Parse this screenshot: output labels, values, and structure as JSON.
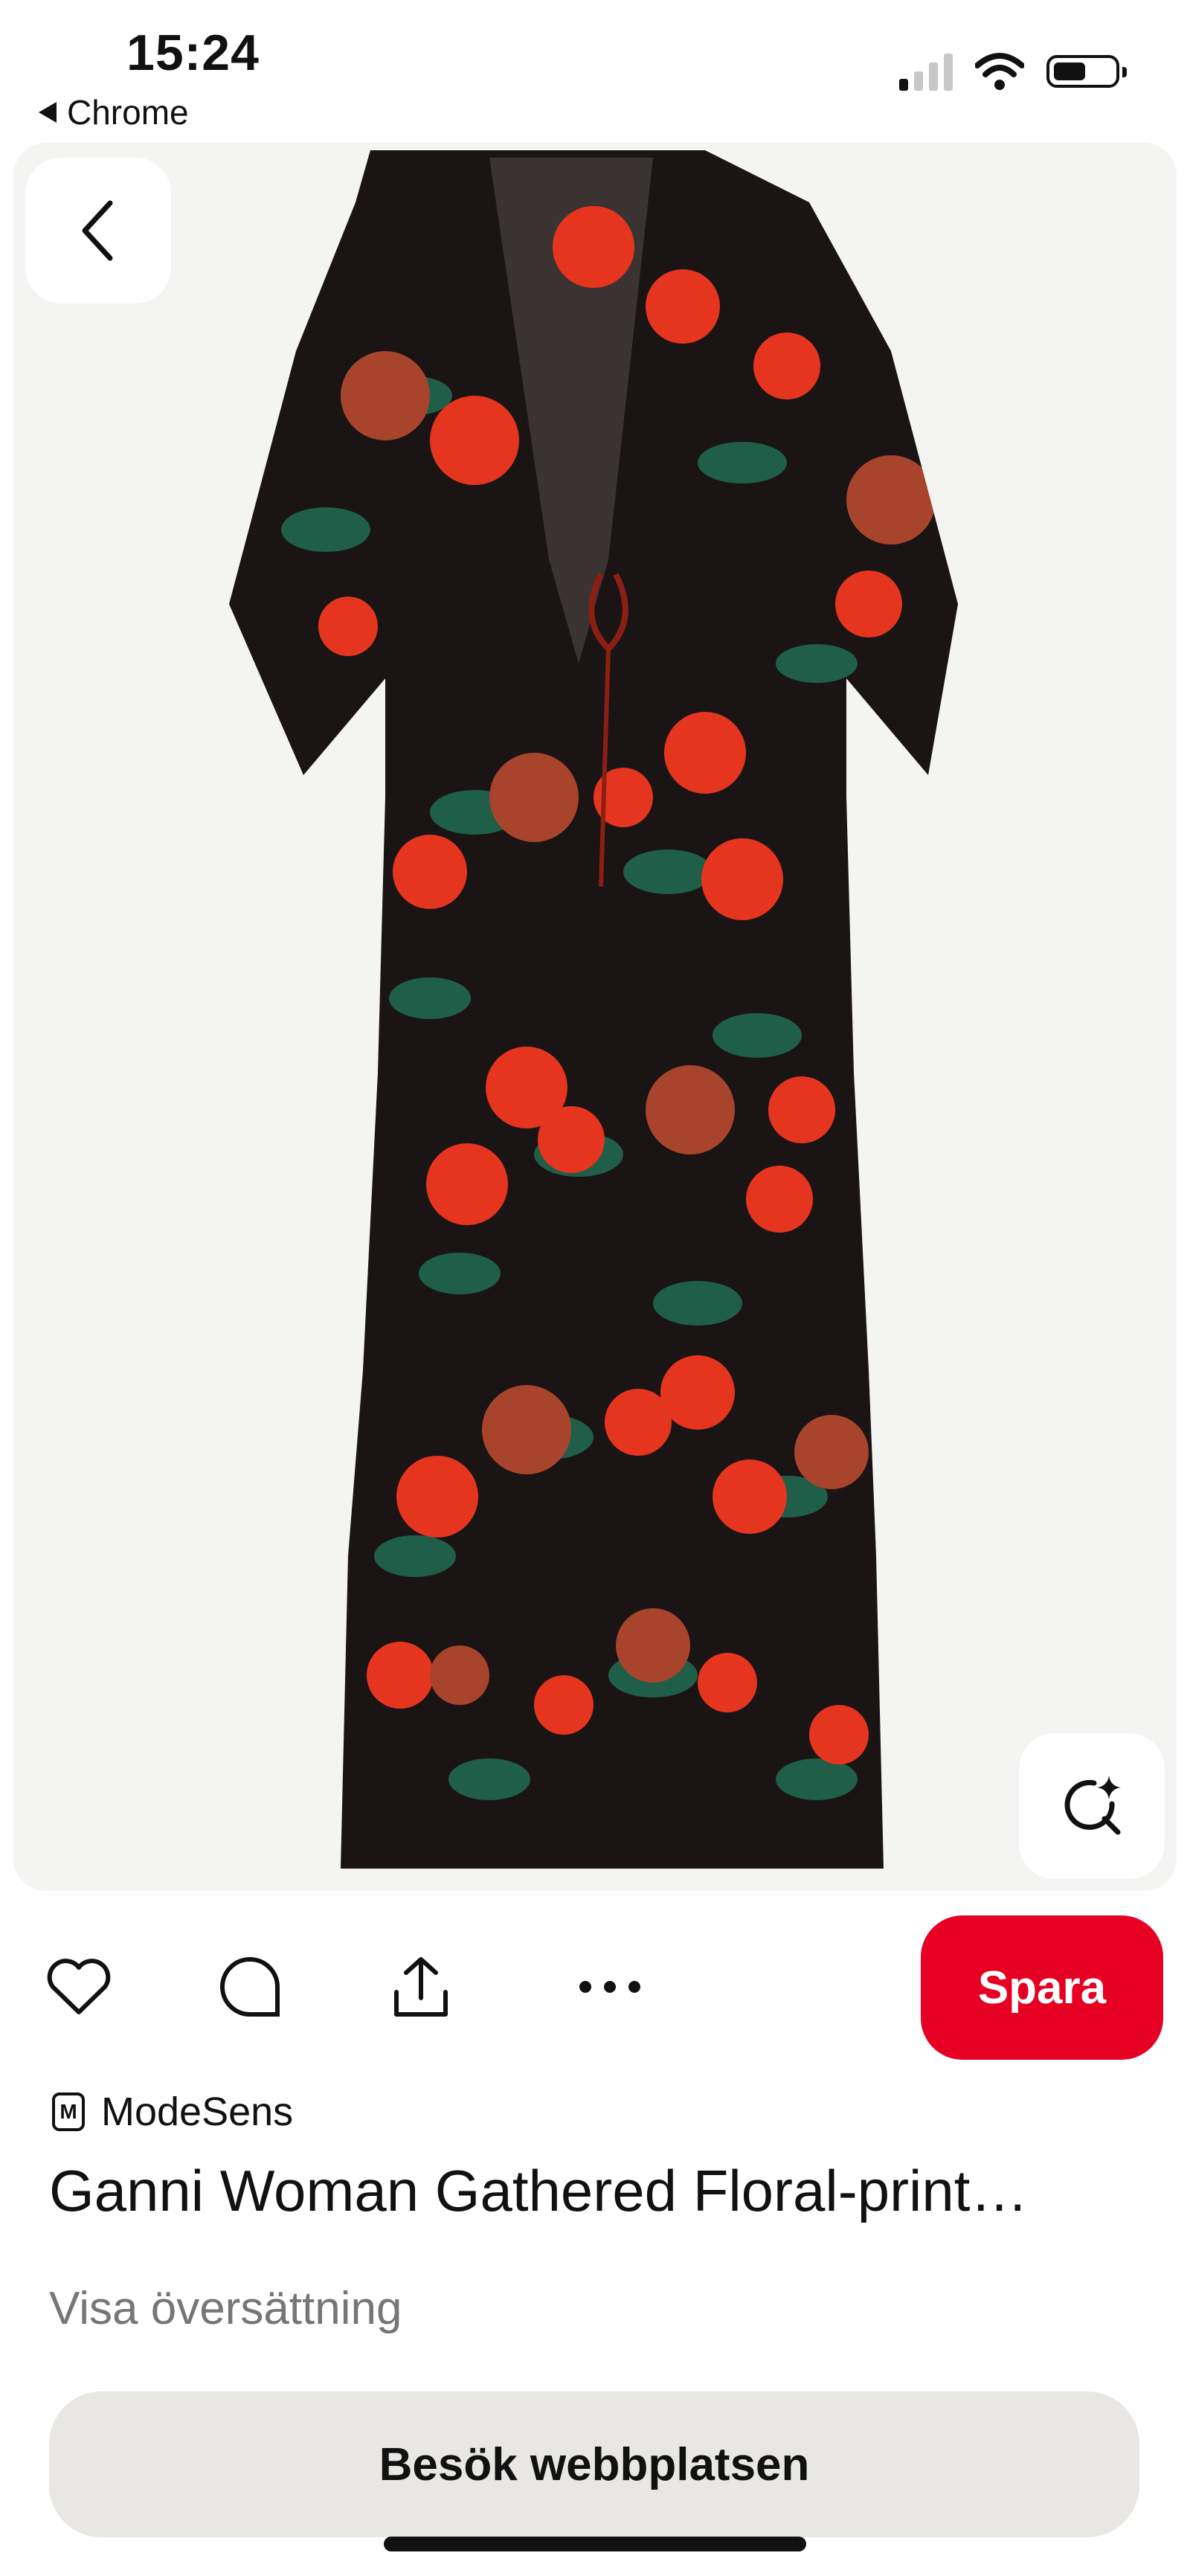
{
  "status_bar": {
    "time": "15:24",
    "back_app": "Chrome",
    "icons": [
      "signal-icon",
      "wifi-icon",
      "battery-icon"
    ]
  },
  "image": {
    "alt": "Ganni Woman Gathered Floral-print dress",
    "background": "#f4f4f2",
    "dress_colors": {
      "base": "#1b1414",
      "flower": "#e5351f",
      "flower_dark": "#a8442c",
      "leaf": "#1f5e48"
    },
    "buttons": {
      "back_icon": "chevron-left-icon",
      "visual_search_icon": "visual-search-icon"
    }
  },
  "actions": {
    "icons": [
      "heart-icon",
      "comment-icon",
      "share-icon",
      "more-icon"
    ],
    "save_label": "Spara",
    "save_color": "#e60023"
  },
  "pin": {
    "source_name": "ModeSens",
    "title": "Ganni Woman Gathered Floral-print…",
    "translate_label": "Visa översättning",
    "visit_label": "Besök webbplatsen"
  }
}
